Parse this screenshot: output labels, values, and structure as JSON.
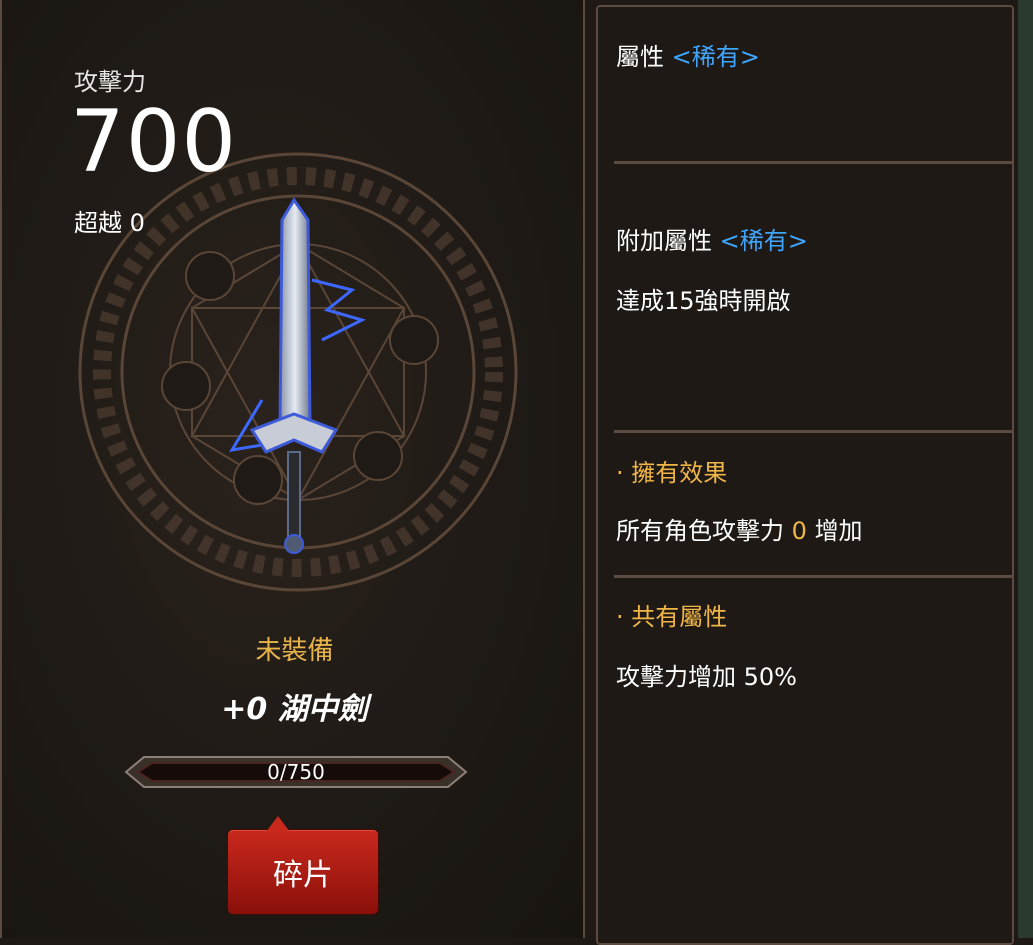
{
  "item": {
    "attack_label": "攻擊力",
    "attack_value": "700",
    "transcend_label": "超越",
    "transcend_value": "0",
    "equip_status": "未裝備",
    "name": "+0 湖中劍",
    "progress_text": "0/750",
    "progress_fraction": 0,
    "shard_button_label": "碎片"
  },
  "attributes": {
    "main_label": "屬性",
    "main_rarity": "<稀有>",
    "extra_label": "附加屬性",
    "extra_rarity": "<稀有>",
    "extra_desc": "達成15強時開啟",
    "owned_title": "· 擁有效果",
    "owned_desc_prefix": "所有角色攻擊力",
    "owned_desc_value": "0",
    "owned_desc_suffix": "增加",
    "shared_title": "· 共有屬性",
    "shared_desc": "攻擊力增加 50%"
  },
  "colors": {
    "rarity": "#3ea6ff",
    "gold": "#f1b646",
    "button_red": "#c9281d",
    "border": "#5b4a3f"
  },
  "icons": {
    "magic_circle": "magic-circle-emblem",
    "weapon": "sword-image"
  }
}
